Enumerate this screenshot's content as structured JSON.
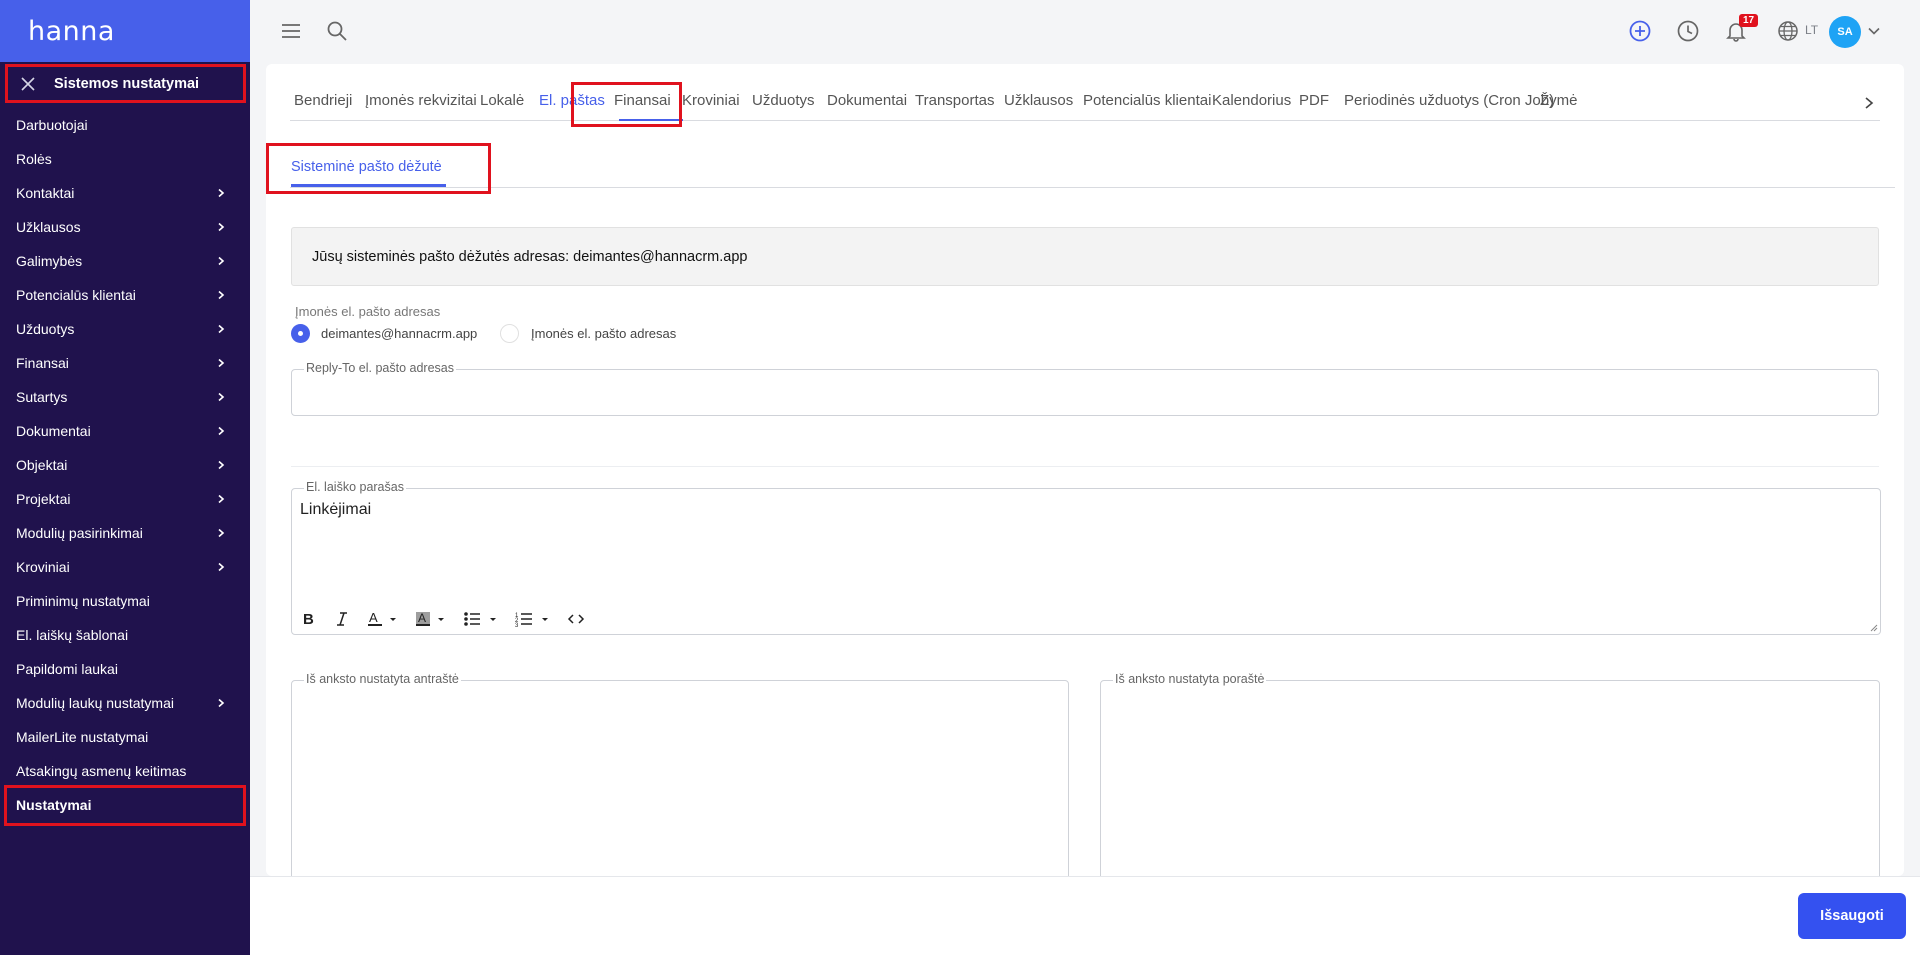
{
  "app": {
    "logo": "hanna"
  },
  "sidebar": {
    "header_title": "Sistemos nustatymai",
    "items": [
      {
        "label": "Darbuotojai",
        "has_children": false
      },
      {
        "label": "Rolės",
        "has_children": false
      },
      {
        "label": "Kontaktai",
        "has_children": true
      },
      {
        "label": "Užklausos",
        "has_children": true
      },
      {
        "label": "Galimybės",
        "has_children": true
      },
      {
        "label": "Potencialūs klientai",
        "has_children": true
      },
      {
        "label": "Užduotys",
        "has_children": true
      },
      {
        "label": "Finansai",
        "has_children": true
      },
      {
        "label": "Sutartys",
        "has_children": true
      },
      {
        "label": "Dokumentai",
        "has_children": true
      },
      {
        "label": "Objektai",
        "has_children": true
      },
      {
        "label": "Projektai",
        "has_children": true
      },
      {
        "label": "Modulių pasirinkimai",
        "has_children": true
      },
      {
        "label": "Kroviniai",
        "has_children": true
      },
      {
        "label": "Priminimų nustatymai",
        "has_children": false
      },
      {
        "label": "El. laiškų šablonai",
        "has_children": false
      },
      {
        "label": "Papildomi laukai",
        "has_children": false
      },
      {
        "label": "Modulių laukų nustatymai",
        "has_children": true
      },
      {
        "label": "MailerLite nustatymai",
        "has_children": false
      },
      {
        "label": "Atsakingų asmenų keitimas",
        "has_children": false
      },
      {
        "label": "Nustatymai",
        "has_children": false,
        "active": true
      }
    ]
  },
  "topbar": {
    "notifications_count": "17",
    "language": "LT",
    "avatar_initials": "SA",
    "icons": [
      "menu-icon",
      "search-icon",
      "add-icon",
      "clock-icon",
      "bell-icon",
      "globe-icon",
      "chevron-down-icon"
    ],
    "accent_color": "#4760ea"
  },
  "tabs": [
    {
      "label": "Bendrieji"
    },
    {
      "label": "Įmonės rekvizitai"
    },
    {
      "label": "Lokalė"
    },
    {
      "label": "El. paštas",
      "active": true
    },
    {
      "label": "Finansai"
    },
    {
      "label": "Kroviniai"
    },
    {
      "label": "Užduotys"
    },
    {
      "label": "Dokumentai"
    },
    {
      "label": "Transportas"
    },
    {
      "label": "Užklausos"
    },
    {
      "label": "Potencialūs klientai"
    },
    {
      "label": "Kalendorius"
    },
    {
      "label": "PDF"
    },
    {
      "label": "Periodinės užduotys (Cron Job)"
    },
    {
      "label": "Žymė"
    }
  ],
  "subtab": {
    "label": "Sisteminė pašto dėžutė"
  },
  "info": {
    "text": "Jūsų sisteminės pašto dėžutės adresas: deimantes@hannacrm.app"
  },
  "sender": {
    "label": "Įmonės el. pašto adresas",
    "options": [
      {
        "label": "deimantes@hannacrm.app",
        "selected": true
      },
      {
        "label": "Įmonės el. pašto adresas",
        "selected": false
      }
    ]
  },
  "reply_to": {
    "label": "Reply-To el. pašto adresas",
    "value": ""
  },
  "signature": {
    "label": "El. laiško parašas",
    "value": "Linkėjimai",
    "toolbar": [
      "bold-icon",
      "italic-icon",
      "font-color-icon",
      "highlight-color-icon",
      "bullet-list-icon",
      "numbered-list-icon",
      "code-view-icon"
    ]
  },
  "header_field": {
    "label": "Iš anksto nustatyta antraštė",
    "value": ""
  },
  "footer_field": {
    "label": "Iš anksto nustatyta poraštė",
    "value": ""
  },
  "footer": {
    "save_label": "Išsaugoti",
    "button_color": "#3451f0"
  },
  "highlight_color": "#e0121e"
}
